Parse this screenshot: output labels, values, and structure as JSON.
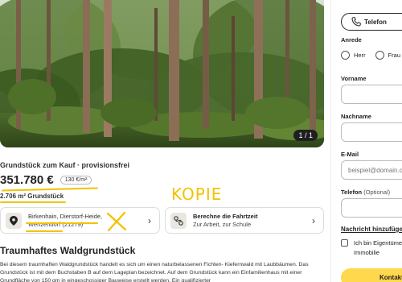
{
  "gallery": {
    "counter": "1 / 1"
  },
  "listing": {
    "type_label": "Grundstück zum Kauf · provisionsfrei",
    "price": "351.780 €",
    "price_per_sqm": "130 €/m²",
    "area": "2.706 m² Grundstück",
    "location": {
      "line1": "Birkenhain, Dierstorf-Heide,",
      "line2": "Wenzendorf (21279)",
      "icon": "map-pin-icon"
    },
    "route": {
      "title": "Berechne die Fahrtzeit",
      "subtitle": "Zur Arbeit, zur Schule",
      "icon": "route-map-icon"
    },
    "section_title": "Traumhaftes Waldgrundstück",
    "description": "Bei diesem traumhaften Waldgrundstück handelt es sich um einen naturbelassenen Fichten- Kiefernwald mit Laubbäumen. Das Grundstück ist mit dem Buchstaben B auf dem Lageplan bezeichnet. Auf dem Grundstück kann ein Einfamilienhaus mit einer Grundfläche von 150 qm in eingeschossiger Bauweise erstellt werden. Ein qualifizierter"
  },
  "annotations": {
    "handwritten_text": "KOPIE",
    "color": "#f2c200"
  },
  "contact_form": {
    "call_button": "Telefon",
    "salutation_label": "Anrede",
    "salutation_options": [
      "Herr",
      "Frau"
    ],
    "first_name_label": "Vorname",
    "last_name_label": "Nachname",
    "email_label": "E-Mail",
    "email_placeholder": "beispiel@domain.de",
    "phone_label": "Telefon",
    "phone_optional": "(Optional)",
    "message_label": "Nachricht hinzufügen",
    "owner_checkbox_line1": "Ich bin Eigentümer",
    "owner_checkbox_line2": "Immobilie",
    "submit_button": "Kontakt"
  },
  "colors": {
    "accent_yellow": "#ffd84d",
    "marker_yellow": "#f2c200",
    "card_border": "#dddddd"
  }
}
